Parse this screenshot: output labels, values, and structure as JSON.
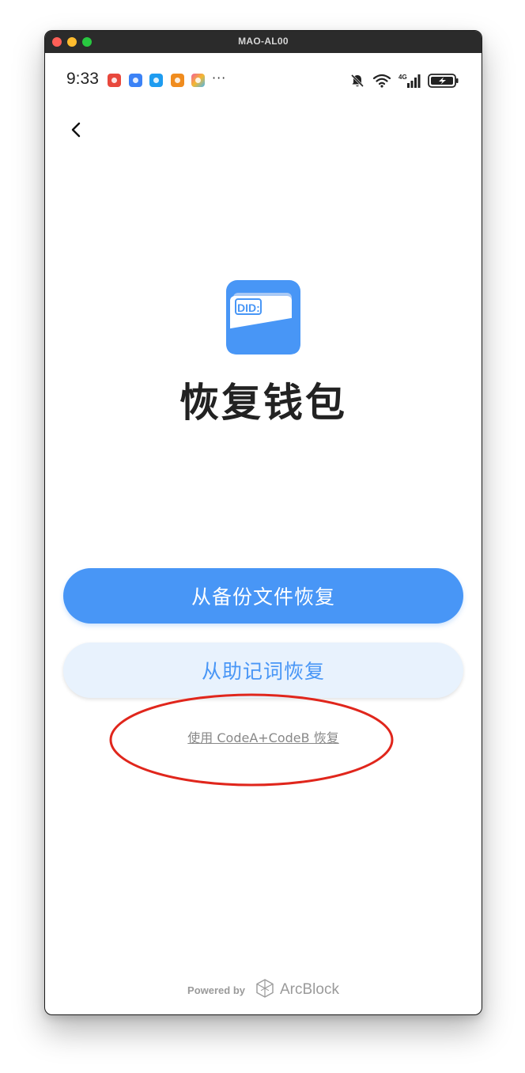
{
  "window": {
    "title": "MAO-AL00"
  },
  "status_bar": {
    "time": "9:33",
    "more": "···",
    "notification_icons": [
      "missed-call-icon",
      "usb-icon",
      "messenger-icon",
      "app-icon",
      "photos-icon"
    ],
    "system_icons": [
      "bell-muted-icon",
      "wifi-icon",
      "signal-4g-icon",
      "battery-charging-icon"
    ]
  },
  "page": {
    "logo_text": "DID:",
    "title": "恢复钱包"
  },
  "actions": {
    "restore_from_backup": "从备份文件恢复",
    "restore_from_mnemonic": "从助记词恢复",
    "restore_with_codes": "使用 CodeA+CodeB 恢复"
  },
  "footer": {
    "powered_by": "Powered by",
    "brand": "ArcBlock"
  },
  "colors": {
    "primary": "#4896f6",
    "secondary_bg": "#e8f2fd",
    "title": "#222222",
    "link": "#888888",
    "annotation": "#e0261c"
  }
}
